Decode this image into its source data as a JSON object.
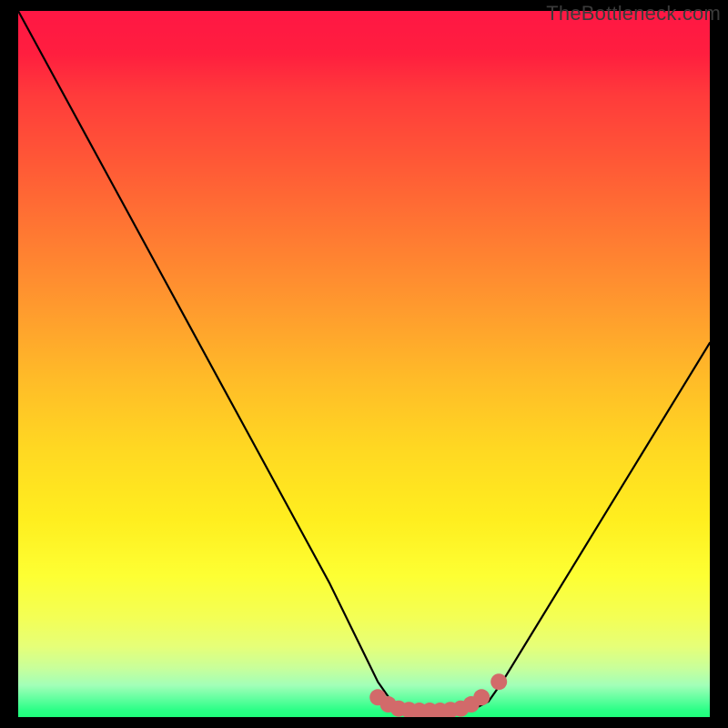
{
  "attribution": "TheBottleneck.com",
  "chart_data": {
    "type": "line",
    "title": "",
    "xlabel": "",
    "ylabel": "",
    "xlim": [
      0,
      100
    ],
    "ylim": [
      0,
      100
    ],
    "series": [
      {
        "name": "bottleneck-curve",
        "x": [
          0,
          5,
          10,
          15,
          20,
          25,
          30,
          35,
          40,
          45,
          50,
          52,
          54,
          56,
          58,
          60,
          62,
          64,
          66,
          68,
          70,
          75,
          80,
          85,
          90,
          95,
          100
        ],
        "values": [
          100,
          91,
          82,
          73,
          64,
          55,
          46,
          37,
          28,
          19,
          9,
          5,
          2.2,
          1.2,
          0.8,
          0.6,
          0.6,
          0.8,
          1.2,
          2.2,
          5,
          13,
          21,
          29,
          37,
          45,
          53
        ]
      }
    ],
    "markers": [
      {
        "name": "bottom-dots",
        "color": "#d26a6a",
        "points": [
          {
            "x": 52.0,
            "y": 2.8
          },
          {
            "x": 53.5,
            "y": 1.8
          },
          {
            "x": 55.0,
            "y": 1.2
          },
          {
            "x": 56.5,
            "y": 1.0
          },
          {
            "x": 58.0,
            "y": 0.9
          },
          {
            "x": 59.5,
            "y": 0.9
          },
          {
            "x": 61.0,
            "y": 0.9
          },
          {
            "x": 62.5,
            "y": 1.0
          },
          {
            "x": 64.0,
            "y": 1.2
          },
          {
            "x": 65.5,
            "y": 1.8
          },
          {
            "x": 67.0,
            "y": 2.8
          },
          {
            "x": 69.5,
            "y": 5.0
          }
        ]
      }
    ],
    "background": {
      "type": "vertical-gradient",
      "stops": [
        {
          "pos": 0,
          "color": "#ff1744"
        },
        {
          "pos": 50,
          "color": "#ffbb28"
        },
        {
          "pos": 80,
          "color": "#fdff33"
        },
        {
          "pos": 100,
          "color": "#1eff7a"
        }
      ]
    }
  }
}
